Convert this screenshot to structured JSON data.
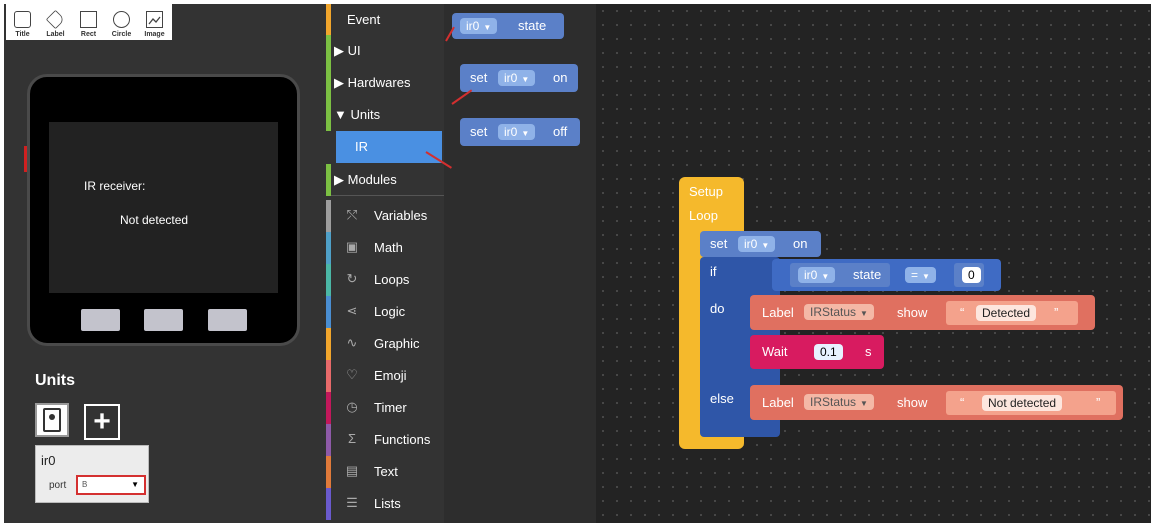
{
  "toolbar": {
    "tools": [
      {
        "label": "Title",
        "icon": "title-icon"
      },
      {
        "label": "Label",
        "icon": "label-icon"
      },
      {
        "label": "Rect",
        "icon": "rect-icon"
      },
      {
        "label": "Circle",
        "icon": "circle-icon"
      },
      {
        "label": "Image",
        "icon": "image-icon"
      }
    ]
  },
  "device": {
    "screen_label1": "IR receiver:",
    "screen_label2": "Not detected"
  },
  "units_panel": {
    "title": "Units",
    "unit_name": "ir0",
    "port_label": "port",
    "port_value": "B"
  },
  "categories": [
    {
      "label": "Event",
      "color": "#f2a62c",
      "arrow": ""
    },
    {
      "label": "UI",
      "color": "#7cc043",
      "arrow": "▶ "
    },
    {
      "label": "Hardwares",
      "color": "#7cc043",
      "arrow": "▶ "
    },
    {
      "label": "Units",
      "color": "#7cc043",
      "arrow": "▼ "
    },
    {
      "label": "IR",
      "color": "#4a90e2",
      "arrow": ""
    },
    {
      "label": "Modules",
      "color": "#7cc043",
      "arrow": "▶ "
    },
    {
      "label": "Variables",
      "color": "#9e9e9e",
      "icon": "variables-icon",
      "glyph": "⤲"
    },
    {
      "label": "Math",
      "color": "#4fa0c8",
      "icon": "math-icon",
      "glyph": "▣"
    },
    {
      "label": "Loops",
      "color": "#4bb7a6",
      "icon": "loops-icon",
      "glyph": "↻"
    },
    {
      "label": "Logic",
      "color": "#4a8ed2",
      "icon": "logic-icon",
      "glyph": "⋖"
    },
    {
      "label": "Graphic",
      "color": "#f2a62c",
      "icon": "graphic-icon",
      "glyph": "∿"
    },
    {
      "label": "Emoji",
      "color": "#e86a6a",
      "icon": "emoji-icon",
      "glyph": "♡"
    },
    {
      "label": "Timer",
      "color": "#c2185b",
      "icon": "timer-icon",
      "glyph": "◷"
    },
    {
      "label": "Functions",
      "color": "#8e5aa8",
      "icon": "functions-icon",
      "glyph": "Σ"
    },
    {
      "label": "Text",
      "color": "#e07a3a",
      "icon": "text-icon",
      "glyph": "▤"
    },
    {
      "label": "Lists",
      "color": "#6a5acd",
      "icon": "lists-icon",
      "glyph": "☰"
    }
  ],
  "flyout": {
    "b1": {
      "var": "ir0",
      "text": "state"
    },
    "b2": {
      "pre": "set",
      "var": "ir0",
      "text": "on"
    },
    "b3": {
      "pre": "set",
      "var": "ir0",
      "text": "off"
    }
  },
  "program": {
    "setup": "Setup",
    "loop": "Loop",
    "set_label": "set",
    "set_var": "ir0",
    "set_state": "on",
    "if_label": "if",
    "do_label": "do",
    "else_label": "else",
    "cond_var": "ir0",
    "cond_text": "state",
    "cond_op": "=",
    "cond_value": "0",
    "label1_kw": "Label",
    "label1_name": "IRStatus",
    "label1_show": "show",
    "label1_text": "Detected",
    "wait_kw": "Wait",
    "wait_value": "0.1",
    "wait_unit": "s",
    "label2_kw": "Label",
    "label2_name": "IRStatus",
    "label2_show": "show",
    "label2_text": "Not detected"
  },
  "colors": {
    "units_blue": "#5b80c8",
    "loop_yellow": "#f5b92c",
    "label_red": "#e07060",
    "wait_pink": "#d81b60",
    "logic_blue": "#3f6bc4"
  }
}
